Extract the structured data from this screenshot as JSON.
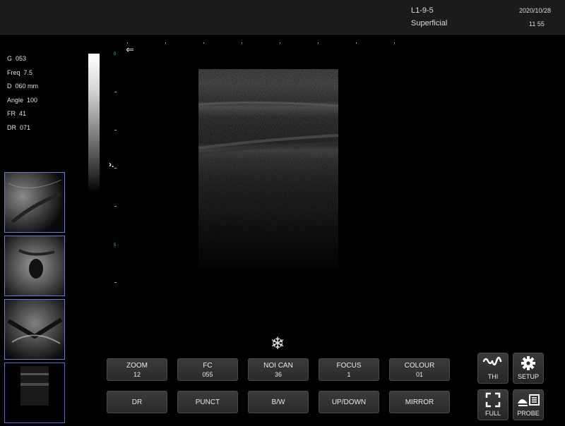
{
  "header": {
    "probe": "L1-9-5",
    "preset": "Superficial",
    "date": "2020/10/28",
    "time": "11  55"
  },
  "params": [
    {
      "label": "G",
      "value": "053"
    },
    {
      "label": "Freq",
      "value": "7.5"
    },
    {
      "label": "D",
      "value": "060 mm"
    },
    {
      "label": "Angle",
      "value": "100"
    },
    {
      "label": "FR",
      "value": "41"
    },
    {
      "label": "DR",
      "value": "071"
    }
  ],
  "depth_marks": [
    "0",
    "5"
  ],
  "controls": {
    "row1": [
      {
        "label": "ZOOM",
        "value": "12"
      },
      {
        "label": "FC",
        "value": "055"
      },
      {
        "label": "NOI CAN",
        "value": "36"
      },
      {
        "label": "FOCUS",
        "value": "1"
      },
      {
        "label": "COLOUR",
        "value": "01"
      }
    ],
    "row2": [
      {
        "label": "DR"
      },
      {
        "label": "PUNCT"
      },
      {
        "label": "B/W"
      },
      {
        "label": "UP/DOWN"
      },
      {
        "label": "MIRROR"
      }
    ]
  },
  "side_buttons": {
    "thi": "THI",
    "setup": "SETUP",
    "full": "FULL",
    "probe": "PROBE"
  },
  "icons": {
    "freeze": "snowflake-icon",
    "back": "back-arrow-icon",
    "thi": "wave-icon",
    "setup": "gear-icon",
    "full": "fullscreen-icon",
    "probe": "probe-icon"
  },
  "glyphs": {
    "freeze": "❄",
    "back": "⇐",
    "focus": "›."
  }
}
